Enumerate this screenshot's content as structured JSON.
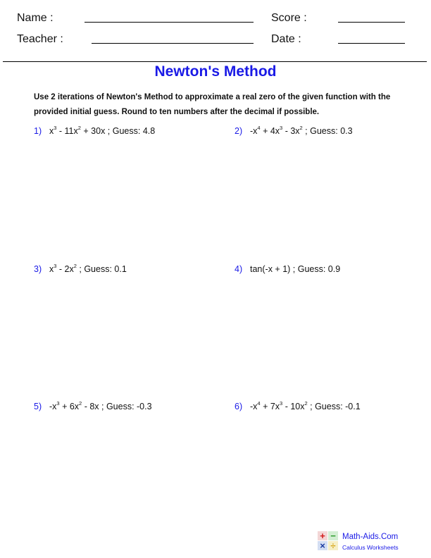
{
  "header": {
    "name_label": "Name :",
    "teacher_label": "Teacher :",
    "score_label": "Score :",
    "date_label": "Date :"
  },
  "title": "Newton's Method",
  "instructions": "Use 2 iterations of Newton's Method to approximate a real zero of the given function with the provided initial guess. Round to ten numbers after the decimal if possible.",
  "problems": [
    {
      "number": "1)",
      "terms": [
        {
          "t": "x"
        },
        {
          "sup": "3"
        },
        {
          "t": " - 11x"
        },
        {
          "sup": "2"
        },
        {
          "t": " + 30x ; Guess: 4.8"
        }
      ]
    },
    {
      "number": "2)",
      "terms": [
        {
          "t": "-x"
        },
        {
          "sup": "4"
        },
        {
          "t": " + 4x"
        },
        {
          "sup": "3"
        },
        {
          "t": " - 3x"
        },
        {
          "sup": "2"
        },
        {
          "t": " ; Guess: 0.3"
        }
      ]
    },
    {
      "number": "3)",
      "terms": [
        {
          "t": "x"
        },
        {
          "sup": "3"
        },
        {
          "t": " - 2x"
        },
        {
          "sup": "2"
        },
        {
          "t": " ; Guess: 0.1"
        }
      ]
    },
    {
      "number": "4)",
      "terms": [
        {
          "t": "tan(-x + 1) ; Guess: 0.9"
        }
      ]
    },
    {
      "number": "5)",
      "terms": [
        {
          "t": "-x"
        },
        {
          "sup": "3"
        },
        {
          "t": " + 6x"
        },
        {
          "sup": "2"
        },
        {
          "t": " - 8x ; Guess: -0.3"
        }
      ]
    },
    {
      "number": "6)",
      "terms": [
        {
          "t": "-x"
        },
        {
          "sup": "4"
        },
        {
          "t": " + 7x"
        },
        {
          "sup": "3"
        },
        {
          "t": " - 10x"
        },
        {
          "sup": "2"
        },
        {
          "t": " ; Guess: -0.1"
        }
      ]
    }
  ],
  "footer": {
    "brand": "Math-Aids.Com",
    "subtitle": "Calculus Worksheets",
    "logo_symbols": [
      "+",
      "−",
      "×",
      "÷"
    ]
  }
}
